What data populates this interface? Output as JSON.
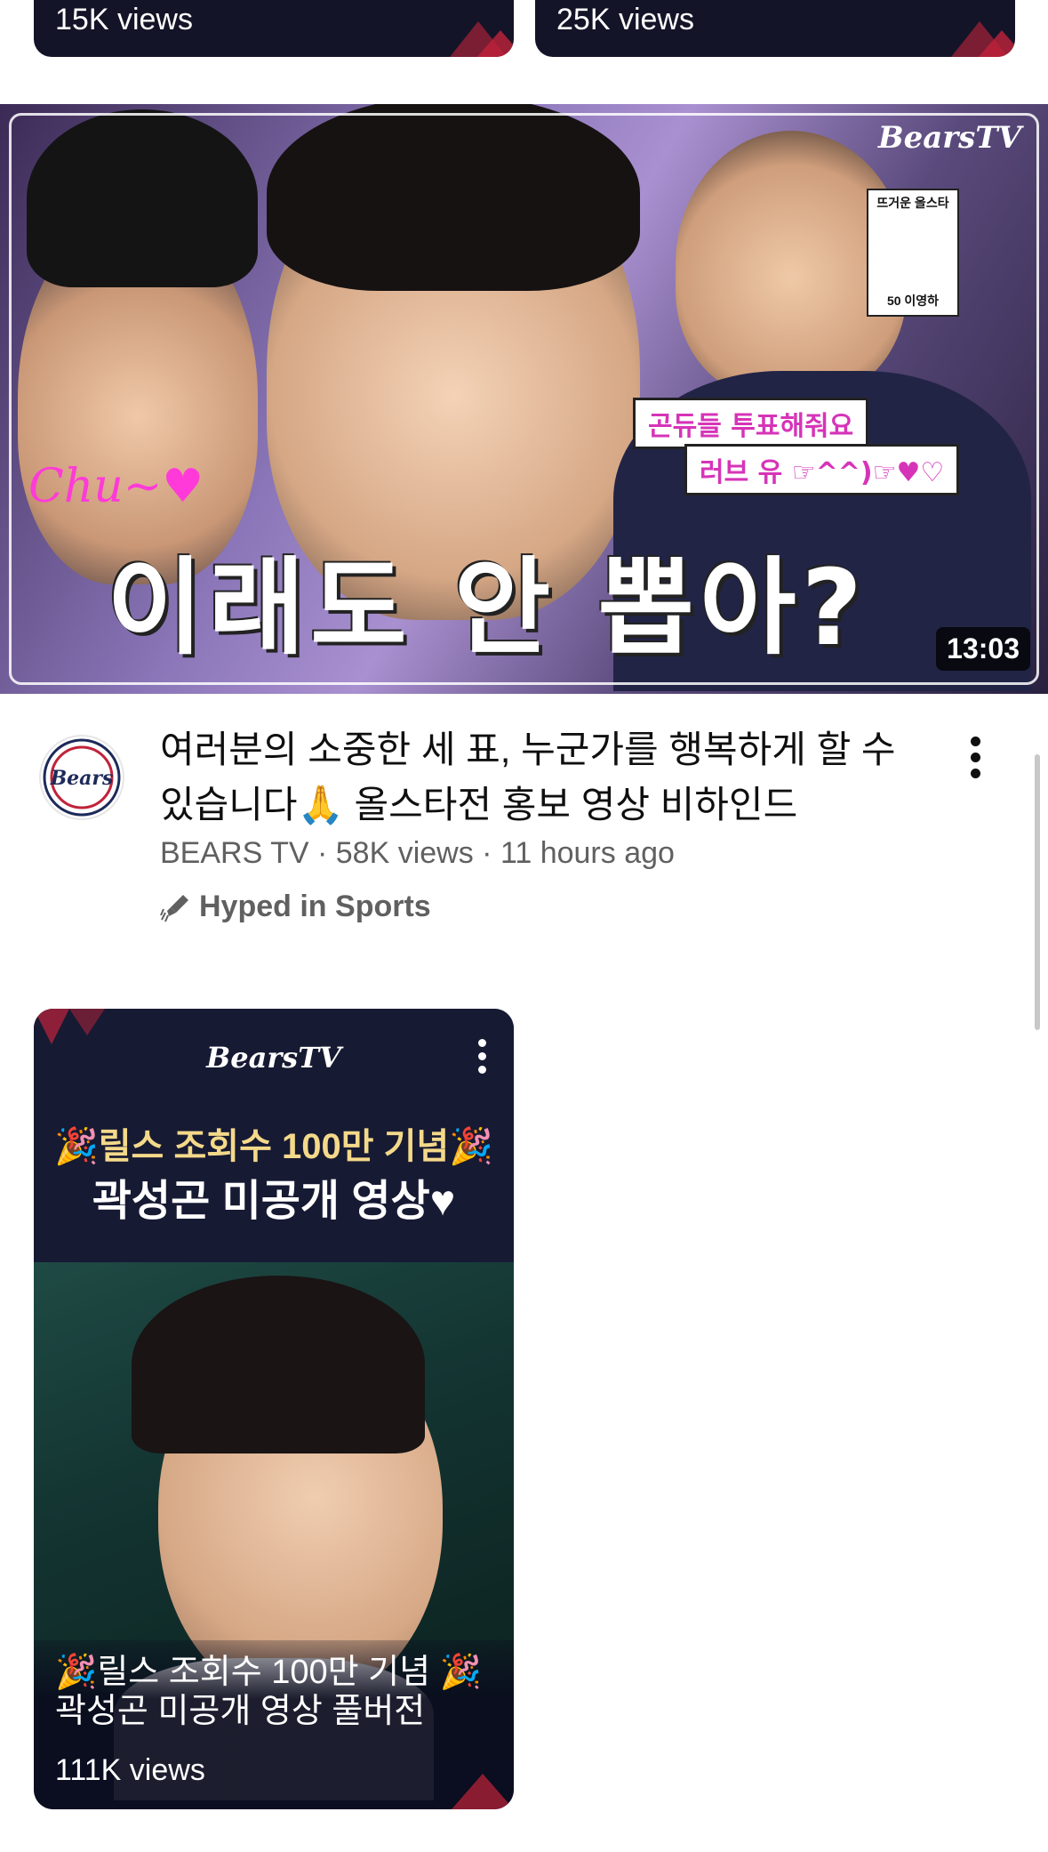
{
  "top_shorts": [
    {
      "views": "15K views"
    },
    {
      "views": "25K views"
    }
  ],
  "video": {
    "thumbnail": {
      "logo_text": "BearsTV",
      "headline": "이래도 안 뽑아?",
      "chu_text": "Chu~♥",
      "sticker_line1": "곤듀들 투표해줘요",
      "sticker_line2": "러브 유 ☞^^)☞♥♡",
      "sign_top": "뜨거운 올스타",
      "sign_bottom": "50 이영하",
      "duration": "13:03"
    },
    "title": "여러분의 소중한 세 표, 누군가를 행복하게 할 수 있습니다🙏 올스타전 홍보 영상 비하인드",
    "channel": "BEARS TV",
    "views": "58K views",
    "age": "11 hours ago",
    "separator": " · ",
    "hype_label": "Hyped in Sports",
    "avatar_text": "Bears"
  },
  "short": {
    "logo_text": "BearsTV",
    "overlay_line1": "🎉릴스 조회수 100만 기념🎉",
    "overlay_line2": "곽성곤 미공개 영상♥",
    "title": "🎉릴스 조회수 100만 기념 🎉곽성곤 미공개 영상 풀버전",
    "views": "111K views"
  },
  "colors": {
    "text_primary": "#0f0f0f",
    "text_secondary": "#606060",
    "shorts_bg": "#171a33",
    "chevron_red": "#c0233a",
    "accent_magenta": "#d634b8"
  }
}
